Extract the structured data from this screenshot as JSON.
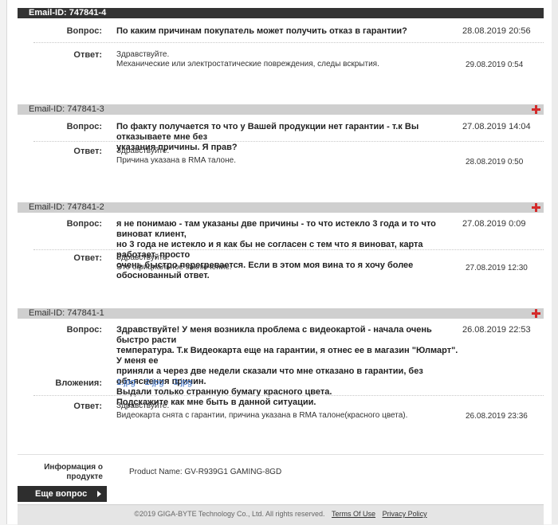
{
  "threads": [
    {
      "email_id": "Email-ID: 747841-4",
      "question_label": "Вопрос:",
      "question": "По каким причинам покупатель может получить отказ в гарантии?",
      "question_date": "28.08.2019 20:56",
      "answer_label": "Ответ:",
      "answer_lines": [
        "Здравствуйте.",
        "Механические или электростатические повреждения, следы вскрытия."
      ],
      "answer_date": "29.08.2019 0:54"
    },
    {
      "email_id": "Email-ID: 747841-3",
      "question_label": "Вопрос:",
      "question_lines": [
        "По факту получается то что у Вашей продукции нет гарантии - т.к Вы отказываете мне без",
        "указания причины. Я прав?"
      ],
      "question_date": "27.08.2019 14:04",
      "answer_label": "Ответ:",
      "answer_lines": [
        "Здравствуйте.",
        "Причина указана в RMA талоне."
      ],
      "answer_date": "28.08.2019 0:50"
    },
    {
      "email_id": "Email-ID: 747841-2",
      "question_label": "Вопрос:",
      "question_lines": [
        "я не понимаю - там указаны две причины - то что истекло 3 года и то что виноват клиент,",
        "но 3 года не истекло и я как бы не согласен с тем что я виноват, карта работает, просто",
        "очень быстро перегревается. Если в этом моя вина то я хочу более обоснованный ответ."
      ],
      "question_date": "27.08.2019 0:09",
      "answer_label": "Ответ:",
      "answer_lines": [
        "Здравствуйте.",
        "Это официальное заключение."
      ],
      "answer_date": "27.08.2019 12:30"
    },
    {
      "email_id": "Email-ID: 747841-1",
      "question_label": "Вопрос:",
      "question_lines": [
        "Здравствуйте! У меня возникла проблема с видеокартой - начала очень быстро расти",
        "температура. Т.к Видеокарта еще на гарантии, я отнес ее в магазин \"Юлмарт\". У меня ее",
        "приняли а через две недели сказали что мне отказано в гарантии, без объяснения причин.",
        "Выдали только странную бумагу красного цвета.",
        "Подскажите как мне быть в данной ситуации."
      ],
      "question_date": "26.08.2019 22:53",
      "attachments_label": "Вложения:",
      "attachments": [
        "1.jpg",
        "2.jpg",
        "3.jpg"
      ],
      "answer_label": "Ответ:",
      "answer_lines": [
        "Здравствуйте.",
        "Видеокарта снята с гарантии, причина указана в RMA талоне(красного цвета)."
      ],
      "answer_date": "26.08.2019 23:36"
    }
  ],
  "product_info": {
    "label_lines": [
      "Информация о",
      "продукте"
    ],
    "value": "Product Name:  GV-R939G1 GAMING-8GD"
  },
  "ask_button": "Еще вопрос",
  "footer": {
    "copyright": "©2019 GIGA-BYTE Technology Co., Ltd. All rights reserved.",
    "terms": "Terms Of Use",
    "privacy": "Privacy Policy"
  },
  "colors": {
    "header_dark": "#333333",
    "header_light": "#cfcfcf",
    "plus_icon": "#d42b2b",
    "link": "#3a6fc4"
  }
}
